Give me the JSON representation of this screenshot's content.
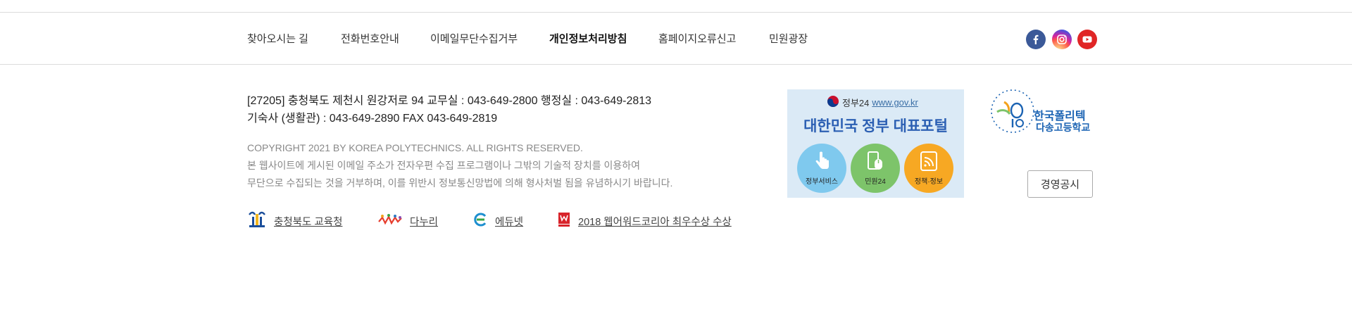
{
  "nav": {
    "items": [
      {
        "label": "찾아오시는 길"
      },
      {
        "label": "전화번호안내"
      },
      {
        "label": "이메일무단수집거부"
      },
      {
        "label": "개인정보처리방침"
      },
      {
        "label": "홈페이지오류신고"
      },
      {
        "label": "민원광장"
      }
    ]
  },
  "social": {
    "facebook_icon": "facebook-icon",
    "instagram_icon": "instagram-icon",
    "youtube_icon": "youtube-icon"
  },
  "address": {
    "line1": "[27205] 충청북도 제천시 원강저로 94   교무실 : 043-649-2800   행정실 : 043-649-2813",
    "line2": "기숙사 (생활관) : 043-649-2890  FAX 043-649-2819"
  },
  "copyright": {
    "line1": "COPYRIGHT 2021 BY KOREA POLYTECHNICS. ALL RIGHTS RESERVED.",
    "line2": "본 웹사이트에 게시된 이메일 주소가 전자우편 수집 프로그램이나 그밖의 기술적 장치를 이용하여",
    "line3": "무단으로 수집되는 것을 거부하며, 이를 위반시 정보통신망법에 의해 형사처벌 됨을 유념하시기 바랍니다."
  },
  "related_links": [
    {
      "label": "충청북도 교육청",
      "icon": "education-office-icon"
    },
    {
      "label": "다누리",
      "icon": "danuri-icon"
    },
    {
      "label": "에듀넷",
      "icon": "edunet-icon"
    },
    {
      "label": "2018 웹어워드코리아 최우수상 수상",
      "icon": "web-award-icon"
    }
  ],
  "gov_banner": {
    "brand": "정부24",
    "url": "www.gov.kr",
    "title": "대한민국 정부 대표포털",
    "services": [
      {
        "label": "정부서비스"
      },
      {
        "label": "민원24"
      },
      {
        "label": "정책·정보"
      }
    ]
  },
  "school_logo": {
    "line1": "한국폴리텍",
    "line2": "다송고등학교"
  },
  "management_button": "경영공시",
  "colors": {
    "gov_blue": "#2b5fb3",
    "logo_blue": "#1b63b3",
    "facebook": "#3b5998",
    "youtube": "#e02626"
  }
}
